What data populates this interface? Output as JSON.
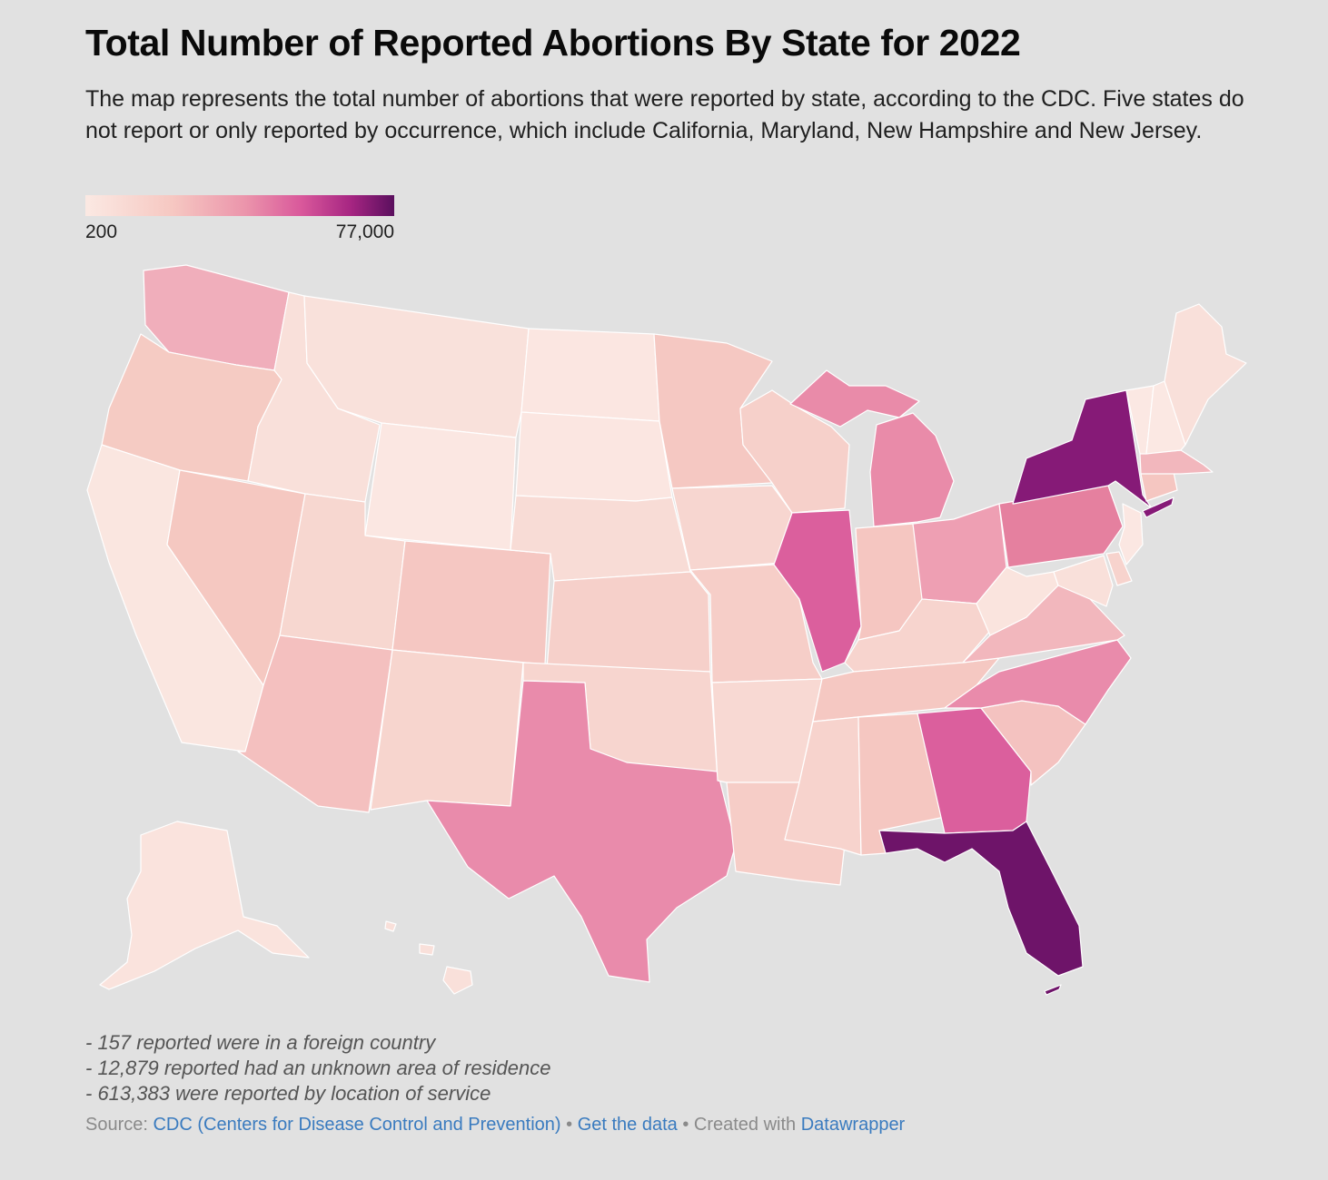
{
  "title": "Total Number of Reported Abortions By State for 2022",
  "intro": "The map represents the total number of abortions that were reported by state, according to the CDC. Five states do not report or only reported by occurrence, which include California, Maryland, New Hampshire and New Jersey.",
  "legend": {
    "min_label": "200",
    "max_label": "77,000",
    "colors": [
      "#fbe9e3",
      "#f6c8c2",
      "#eb94ab",
      "#d9589b",
      "#a62582",
      "#5a0f5e"
    ]
  },
  "map": {
    "type": "choropleth",
    "states": [
      {
        "name": "Washington",
        "color": "#f0aebb"
      },
      {
        "name": "Oregon",
        "color": "#f5cbc3"
      },
      {
        "name": "California",
        "color": "#fae6e0"
      },
      {
        "name": "Nevada",
        "color": "#f5c8c1"
      },
      {
        "name": "Idaho",
        "color": "#f9e0da"
      },
      {
        "name": "Montana",
        "color": "#f9e1db"
      },
      {
        "name": "Wyoming",
        "color": "#fbe7e2"
      },
      {
        "name": "Utah",
        "color": "#f7d7d0"
      },
      {
        "name": "Arizona",
        "color": "#f4c0bf"
      },
      {
        "name": "Colorado",
        "color": "#f5c7c2"
      },
      {
        "name": "New Mexico",
        "color": "#f7d5ce"
      },
      {
        "name": "North Dakota",
        "color": "#fbe6e1"
      },
      {
        "name": "South Dakota",
        "color": "#fbe6e1"
      },
      {
        "name": "Nebraska",
        "color": "#f8dcd6"
      },
      {
        "name": "Kansas",
        "color": "#f6d0ca"
      },
      {
        "name": "Oklahoma",
        "color": "#f7d5cf"
      },
      {
        "name": "Texas",
        "color": "#e98bab"
      },
      {
        "name": "Minnesota",
        "color": "#f5c8c2"
      },
      {
        "name": "Iowa",
        "color": "#f7d6d0"
      },
      {
        "name": "Missouri",
        "color": "#f6cec8"
      },
      {
        "name": "Arkansas",
        "color": "#f8d9d3"
      },
      {
        "name": "Louisiana",
        "color": "#f6cdc7"
      },
      {
        "name": "Wisconsin",
        "color": "#f6d0ca"
      },
      {
        "name": "Illinois",
        "color": "#db5f9d"
      },
      {
        "name": "Michigan",
        "color": "#e98ba9"
      },
      {
        "name": "Indiana",
        "color": "#f5c6c1"
      },
      {
        "name": "Ohio",
        "color": "#ee9fb3"
      },
      {
        "name": "Kentucky",
        "color": "#f7d4ce"
      },
      {
        "name": "Tennessee",
        "color": "#f5c8c2"
      },
      {
        "name": "Mississippi",
        "color": "#f7d3cd"
      },
      {
        "name": "Alabama",
        "color": "#f5c7c1"
      },
      {
        "name": "Georgia",
        "color": "#db5f9d"
      },
      {
        "name": "Florida",
        "color": "#6e1469"
      },
      {
        "name": "South Carolina",
        "color": "#f4c2c0"
      },
      {
        "name": "North Carolina",
        "color": "#e98bab"
      },
      {
        "name": "Virginia",
        "color": "#f2b7bd"
      },
      {
        "name": "West Virginia",
        "color": "#fae4de"
      },
      {
        "name": "Pennsylvania",
        "color": "#e5809f"
      },
      {
        "name": "New York",
        "color": "#861a77"
      },
      {
        "name": "Maryland",
        "color": "#f9e0da"
      },
      {
        "name": "Delaware",
        "color": "#f7d3cd"
      },
      {
        "name": "New Jersey",
        "color": "#fbe7e2"
      },
      {
        "name": "Connecticut",
        "color": "#f5c6c1"
      },
      {
        "name": "Massachusetts",
        "color": "#f2b7bd"
      },
      {
        "name": "Vermont",
        "color": "#fbe8e3"
      },
      {
        "name": "New Hampshire",
        "color": "#fbe8e3"
      },
      {
        "name": "Maine",
        "color": "#f9e0da"
      },
      {
        "name": "Alaska",
        "color": "#fae3dd"
      },
      {
        "name": "Hawaii",
        "color": "#f9e0da"
      }
    ]
  },
  "notes": [
    "- 157 reported were in a foreign country",
    "- 12,879 reported had an unknown area of residence",
    "- 613,383 were reported by location of service"
  ],
  "footer": {
    "source_prefix": "Source: ",
    "source_link": "CDC (Centers for Disease Control and Prevention)",
    "sep1": " • ",
    "data_link": "Get the data",
    "sep2": " • Created with ",
    "tool_link": "Datawrapper"
  }
}
